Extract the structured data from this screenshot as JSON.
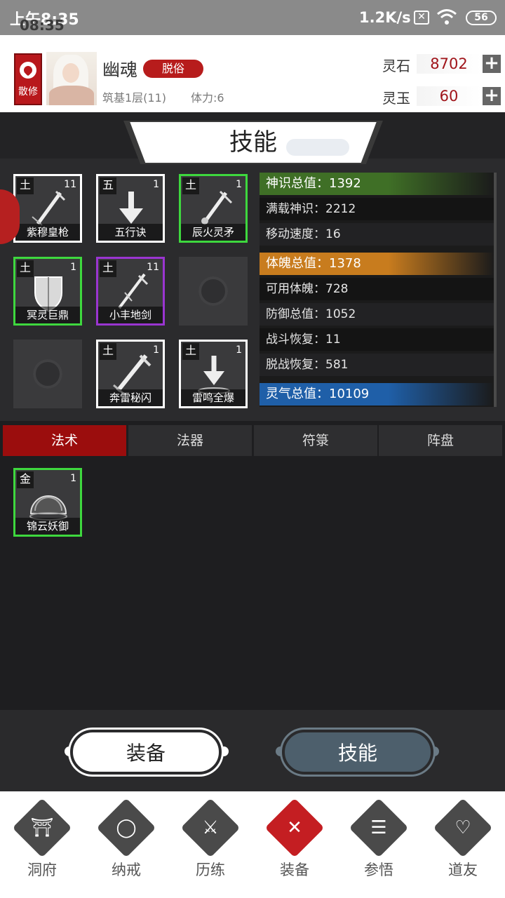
{
  "status": {
    "time": "上午8:35",
    "time_shadow": "08:35",
    "net_speed": "1.2K/s",
    "battery": "56"
  },
  "profile": {
    "badge": "散修",
    "name": "幽魂",
    "tag": "脱俗",
    "realm": "筑基1层(11)",
    "stamina": "体力:6"
  },
  "currency": {
    "spirit_stone_label": "灵石",
    "spirit_stone_value": "8702",
    "spirit_jade_label": "灵玉",
    "spirit_jade_value": "60",
    "plus": "+"
  },
  "panel_title": "技能",
  "skills": [
    {
      "element": "土",
      "level": "11",
      "name": "紫穆皇枪",
      "frame": "white"
    },
    {
      "element": "五",
      "level": "1",
      "name": "五行诀",
      "frame": "white"
    },
    {
      "element": "土",
      "level": "1",
      "name": "辰火灵矛",
      "frame": "green"
    },
    {
      "element": "土",
      "level": "1",
      "name": "冥灵巨鼎",
      "frame": "green"
    },
    {
      "element": "土",
      "level": "11",
      "name": "小丰地剑",
      "frame": "purple"
    },
    {
      "element": "土",
      "level": "1",
      "name": "奔雷秘闪",
      "frame": "white"
    },
    {
      "element": "土",
      "level": "1",
      "name": "雷鸣全爆",
      "frame": "white"
    }
  ],
  "stats": [
    {
      "text": "神识总值：1392",
      "type": "header",
      "color": "#3f6f26"
    },
    {
      "text": "满载神识：2212",
      "type": "dark"
    },
    {
      "text": "移动速度：16",
      "type": "plain"
    },
    {
      "text": "体魄总值：1378",
      "type": "header",
      "color": "#c87c1e"
    },
    {
      "text": "可用体魄：728",
      "type": "dark"
    },
    {
      "text": "防御总值：1052",
      "type": "plain"
    },
    {
      "text": "战斗恢复：11",
      "type": "dark"
    },
    {
      "text": "脱战恢复：581",
      "type": "plain"
    },
    {
      "text": "灵气总值：10109",
      "type": "header",
      "color": "#1f5fa8"
    }
  ],
  "tabs": [
    "法术",
    "法器",
    "符箓",
    "阵盘"
  ],
  "spell": {
    "element": "金",
    "level": "1",
    "name": "锦云妖御"
  },
  "buttons": {
    "equip": "装备",
    "skill": "技能"
  },
  "nav": [
    "洞府",
    "纳戒",
    "历练",
    "装备",
    "参悟",
    "道友"
  ]
}
